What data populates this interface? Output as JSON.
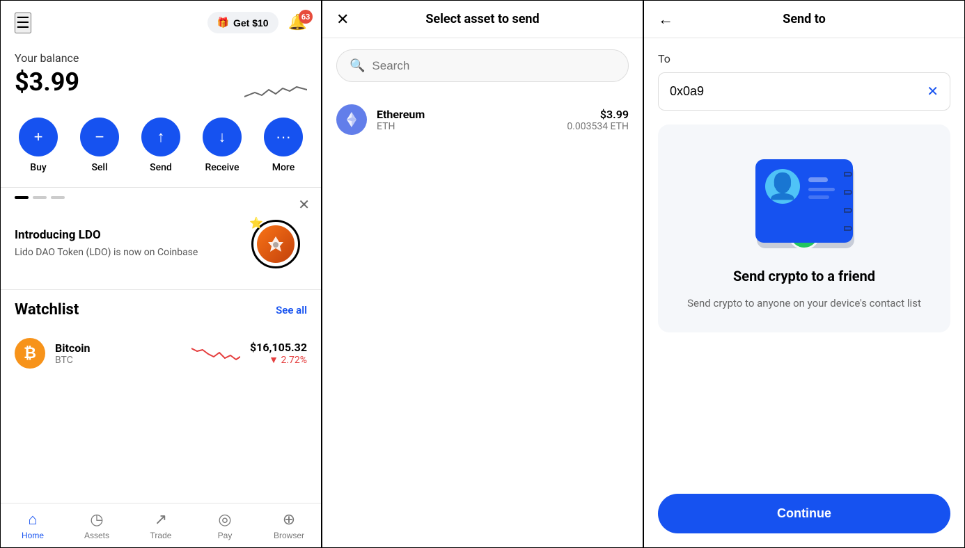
{
  "left": {
    "header": {
      "get_label": "Get $10",
      "notification_count": "63"
    },
    "balance": {
      "label": "Your balance",
      "amount": "$3.99"
    },
    "actions": [
      {
        "id": "buy",
        "label": "Buy",
        "icon": "+"
      },
      {
        "id": "sell",
        "label": "Sell",
        "icon": "−"
      },
      {
        "id": "send",
        "label": "Send",
        "icon": "↑"
      },
      {
        "id": "receive",
        "label": "Receive",
        "icon": "↓"
      },
      {
        "id": "more",
        "label": "More",
        "icon": "···"
      }
    ],
    "promo": {
      "title": "Introducing LDO",
      "description": "Lido DAO Token (LDO) is now on Coinbase"
    },
    "watchlist": {
      "title": "Watchlist",
      "see_all": "See all",
      "items": [
        {
          "name": "Bitcoin",
          "ticker": "BTC",
          "price": "$16,105.32",
          "change": "▼ 2.72%"
        }
      ]
    },
    "nav": [
      {
        "id": "home",
        "label": "Home",
        "icon": "⌂",
        "active": true
      },
      {
        "id": "assets",
        "label": "Assets",
        "icon": "○"
      },
      {
        "id": "trade",
        "label": "Trade",
        "icon": "↗"
      },
      {
        "id": "pay",
        "label": "Pay",
        "icon": "◎"
      },
      {
        "id": "browser",
        "label": "Browser",
        "icon": "⊕"
      }
    ]
  },
  "middle": {
    "header": {
      "title": "Select asset to send",
      "close_icon": "✕"
    },
    "search": {
      "placeholder": "Search"
    },
    "assets": [
      {
        "name": "Ethereum",
        "ticker": "ETH",
        "usd_value": "$3.99",
        "crypto_value": "0.003534 ETH"
      }
    ]
  },
  "right": {
    "header": {
      "title": "Send to",
      "back_icon": "←"
    },
    "to_label": "To",
    "address_value": "0x0a9",
    "illustration": {
      "title": "Send crypto to a friend",
      "description": "Send crypto to anyone on your device's contact list"
    },
    "continue_label": "Continue"
  }
}
